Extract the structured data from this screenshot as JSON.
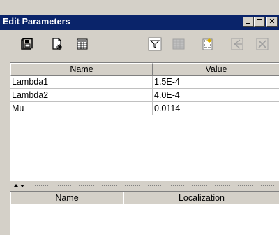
{
  "window": {
    "title": "Edit Parameters"
  },
  "toolbar": {
    "buttons": [
      {
        "icon": "save-icon",
        "enabled": true
      },
      {
        "icon": "new-document-icon",
        "enabled": true
      },
      {
        "icon": "table-icon",
        "enabled": true
      },
      {
        "icon": "filter-icon",
        "enabled": true
      },
      {
        "icon": "grid-icon",
        "enabled": false
      },
      {
        "icon": "paste-icon",
        "enabled": true
      },
      {
        "icon": "back-icon",
        "enabled": false
      },
      {
        "icon": "delete-icon",
        "enabled": false
      }
    ]
  },
  "parameters_table": {
    "columns": [
      "Name",
      "Value"
    ],
    "rows": [
      {
        "name": "Lambda1",
        "value": "1.5E-4"
      },
      {
        "name": "Lambda2",
        "value": "4.0E-4"
      },
      {
        "name": "Mu",
        "value": "0.0114"
      }
    ]
  },
  "localization_table": {
    "columns": [
      "Name",
      "Localization"
    ],
    "rows": []
  },
  "colors": {
    "titlebar": "#0a246a",
    "face": "#d4d0c8"
  }
}
